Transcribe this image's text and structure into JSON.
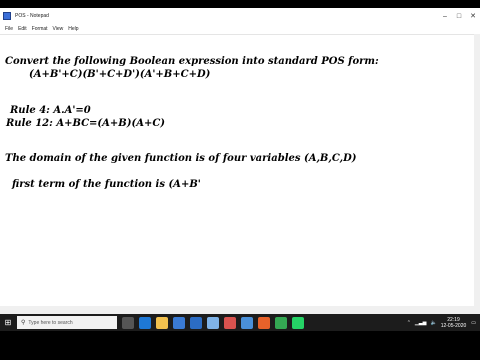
{
  "window": {
    "title": "POS - Notepad"
  },
  "menu": [
    "File",
    "Edit",
    "Format",
    "View",
    "Help"
  ],
  "editor": {
    "lines": [
      "Convert the following Boolean expression into standard POS form:",
      "(A+B'+C)(B'+C+D')(A'+B+C+D)",
      "Rule 4:  A.A'=0",
      "Rule 12: A+BC=(A+B)(A+C)",
      "The domain of the given function is of four variables (A,B,C,D)",
      "first term of the function is  (A+B'"
    ]
  },
  "taskbar": {
    "search_placeholder": "Type here to search",
    "time": "22:19",
    "date": "12-05-2020",
    "apps": [
      "task-view",
      "edge",
      "file-explorer",
      "store",
      "mail",
      "notepad",
      "paint",
      "photos",
      "office",
      "chrome",
      "whatsapp"
    ],
    "colors": {
      "taskbar": "#1c1c1c",
      "search": "#f2f2f2"
    }
  }
}
